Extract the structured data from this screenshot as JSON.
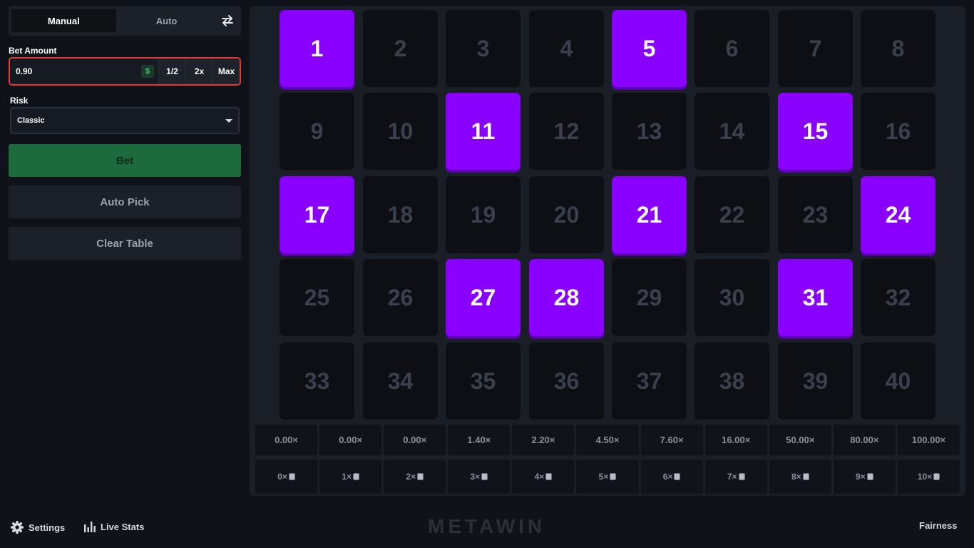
{
  "tabs": {
    "manual": "Manual",
    "auto": "Auto"
  },
  "bet": {
    "label": "Bet Amount",
    "value": "0.90",
    "currency": "$",
    "half": "1/2",
    "double": "2x",
    "max": "Max"
  },
  "risk": {
    "label": "Risk",
    "value": "Classic"
  },
  "buttons": {
    "bet": "Bet",
    "auto_pick": "Auto Pick",
    "clear": "Clear Table"
  },
  "tiles": {
    "numbers": [
      "1",
      "2",
      "3",
      "4",
      "5",
      "6",
      "7",
      "8",
      "9",
      "10",
      "11",
      "12",
      "13",
      "14",
      "15",
      "16",
      "17",
      "18",
      "19",
      "20",
      "21",
      "22",
      "23",
      "24",
      "25",
      "26",
      "27",
      "28",
      "29",
      "30",
      "31",
      "32",
      "33",
      "34",
      "35",
      "36",
      "37",
      "38",
      "39",
      "40"
    ],
    "picked": [
      1,
      5,
      11,
      15,
      17,
      21,
      24,
      27,
      28,
      31
    ]
  },
  "multipliers": [
    "0.00×",
    "0.00×",
    "0.00×",
    "1.40×",
    "2.20×",
    "4.50×",
    "7.60×",
    "16.00×",
    "50.00×",
    "80.00×",
    "100.00×"
  ],
  "hits": [
    "0×",
    "1×",
    "2×",
    "3×",
    "4×",
    "5×",
    "6×",
    "7×",
    "8×",
    "9×",
    "10×"
  ],
  "footer": {
    "settings": "Settings",
    "live_stats": "Live Stats",
    "logo": "METAWIN",
    "fairness": "Fairness"
  },
  "colors": {
    "picked": "#8a00ff",
    "bet_button": "#1d6b3d",
    "bet_border": "#e03b3b"
  },
  "icons": {
    "swap": "swap-arrows-icon",
    "settings": "gear-icon",
    "stats": "bar-chart-icon",
    "dropdown": "chevron-down-icon",
    "gem": "gem-icon"
  }
}
